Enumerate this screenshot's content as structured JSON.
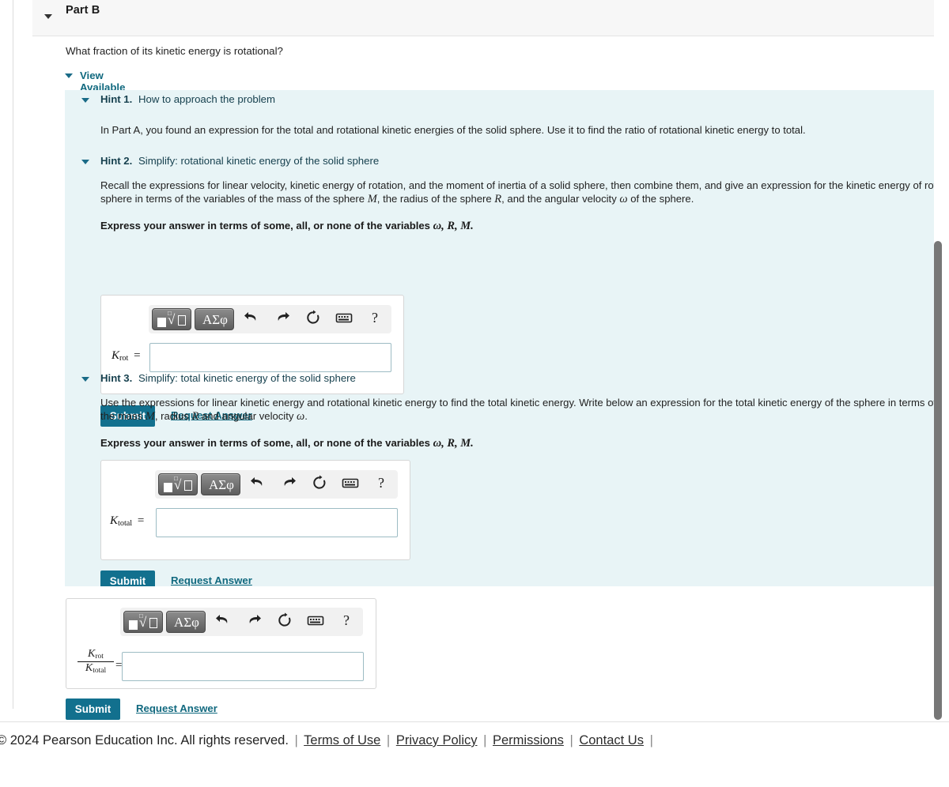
{
  "part": {
    "title": "Part B",
    "question": "What fraction of its kinetic energy is rotational?",
    "view_hints_label": "View Available Hint(s)"
  },
  "hints": [
    {
      "number": "Hint 1.",
      "subtitle": "How to approach the problem",
      "body": "In Part A, you found an expression for the total and rotational kinetic energies of the solid sphere. Use it to find the ratio of rotational kinetic energy to total."
    },
    {
      "number": "Hint 2.",
      "subtitle": "Simplify: rotational kinetic energy of the solid sphere",
      "body_part1": "Recall the expressions for linear velocity, kinetic energy of rotation, and the moment of inertia of a solid sphere, then combine them, and give an expression for the kinetic energy of rotation of a",
      "body_part2a": "sphere in terms of the variables of the mass of the sphere ",
      "body_var_m": "M",
      "body_part2b": ", the radius of the sphere ",
      "body_var_r": "R",
      "body_part2c": ", and the angular velocity ",
      "body_var_w": "ω",
      "body_part2d": " of the sphere.",
      "express_prefix": "Express your answer in terms of some, all, or none of the variables ",
      "express_vars": "ω, R, M.",
      "answer_label_base": "K",
      "answer_label_sub": "rot",
      "answer_equals": "=",
      "submit_label": "Submit",
      "request_answer_label": "Request Answer"
    },
    {
      "number": "Hint 3.",
      "subtitle": "Simplify: total kinetic energy of the solid sphere",
      "body_part1": "Use the expressions for linear kinetic energy and rotational kinetic energy to find the total kinetic energy. Write below an expression for the total kinetic energy of the sphere in terms of the",
      "body_part2a": "the mass ",
      "body_var_m": "M",
      "body_part2b": ", radius ",
      "body_var_r": "R",
      "body_part2c": " and angular velocity ",
      "body_var_w": "ω",
      "body_part2d": ".",
      "express_prefix": "Express your answer in terms of some, all, or none of the variables ",
      "express_vars": "ω, R, M.",
      "answer_label_base": "K",
      "answer_label_sub": "total",
      "answer_equals": "=",
      "submit_label": "Submit",
      "request_answer_label": "Request Answer"
    }
  ],
  "math_toolbar": {
    "template_button": "template-sqrt",
    "greek_button": "ΑΣφ",
    "undo": "undo-arrow",
    "redo": "redo-arrow",
    "reset": "reset-circle",
    "keyboard": "keyboard",
    "help": "?"
  },
  "main_answer": {
    "numerator_base": "K",
    "numerator_sub": "rot",
    "denominator_base": "K",
    "denominator_sub": "total",
    "equals": "=",
    "value": "",
    "submit_label": "Submit",
    "request_answer_label": "Request Answer"
  },
  "footer": {
    "copyright": "© 2024  Pearson Education Inc. All rights reserved.",
    "separator": "|",
    "links": [
      "Terms of Use",
      "Privacy Policy",
      "Permissions",
      "Contact Us"
    ]
  },
  "colors": {
    "hint_panel_bg": "#e8f4f6",
    "link_blue": "#11697f",
    "submit_bg": "#12708e",
    "header_bg": "#f7f7f7"
  }
}
